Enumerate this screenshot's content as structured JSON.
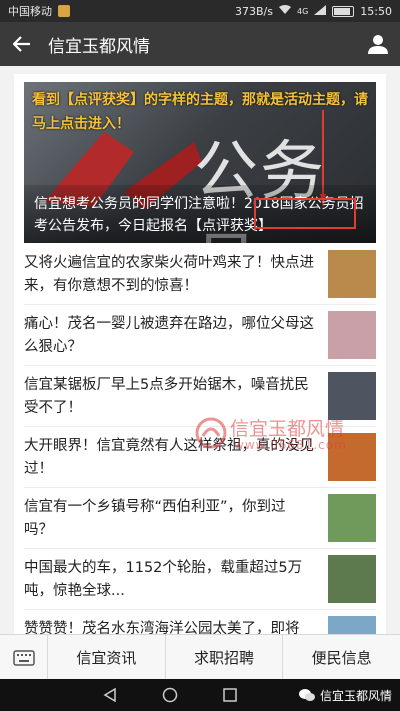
{
  "status_bar": {
    "carrier": "中国移动",
    "speed": "373B/s",
    "network": "4G",
    "time": "15:50"
  },
  "header": {
    "title": "信宜玉都风情",
    "back_icon": "back-arrow-icon",
    "profile_icon": "person-icon"
  },
  "hero": {
    "annotation": "看到【点评获奖】的字样的主题，那就是活动主题，请马上点击进入！",
    "background_text": "公务员",
    "caption": "信宜想考公务员的同学们注意啦！2018国家公务员招考公告发布，今日起报名【点评获奖】"
  },
  "articles": [
    {
      "title": "又将火遍信宜的农家柴火荷叶鸡来了！快点进来，有你意想不到的惊喜！",
      "thumb_color": "#b98a4c"
    },
    {
      "title": "痛心！茂名一婴儿被遗弃在路边，哪位父母这么狠心？",
      "thumb_color": "#c9a0a8"
    },
    {
      "title": "信宜某锯板厂早上5点多开始锯木，噪音扰民受不了！",
      "thumb_color": "#4e5561"
    },
    {
      "title": "大开眼界！信宜竟然有人这样祭祖，真的没见过！",
      "thumb_color": "#c46a2e"
    },
    {
      "title": "信宜有一个乡镇号称“西伯利亚”，你到过吗？",
      "thumb_color": "#6f9a5c"
    },
    {
      "title": "中国最大的车，1152个轮胎，载重超过5万吨，惊艳全球...",
      "thumb_color": "#5d7a4e"
    },
    {
      "title": "赞赞赞！茂名水东湾海洋公园太美了，即将",
      "thumb_color": "#7da7c6"
    }
  ],
  "watermark": {
    "name": "信宜玉都风情",
    "url": "www.06681.com"
  },
  "menu": {
    "keyboard_icon": "keyboard-icon",
    "items": [
      "信宜资讯",
      "求职招聘",
      "便民信息"
    ]
  },
  "navbar": {
    "back_icon": "nav-back-icon",
    "home_icon": "nav-home-icon",
    "recent_icon": "nav-recent-icon",
    "wechat_label": "信宜玉都风情"
  }
}
